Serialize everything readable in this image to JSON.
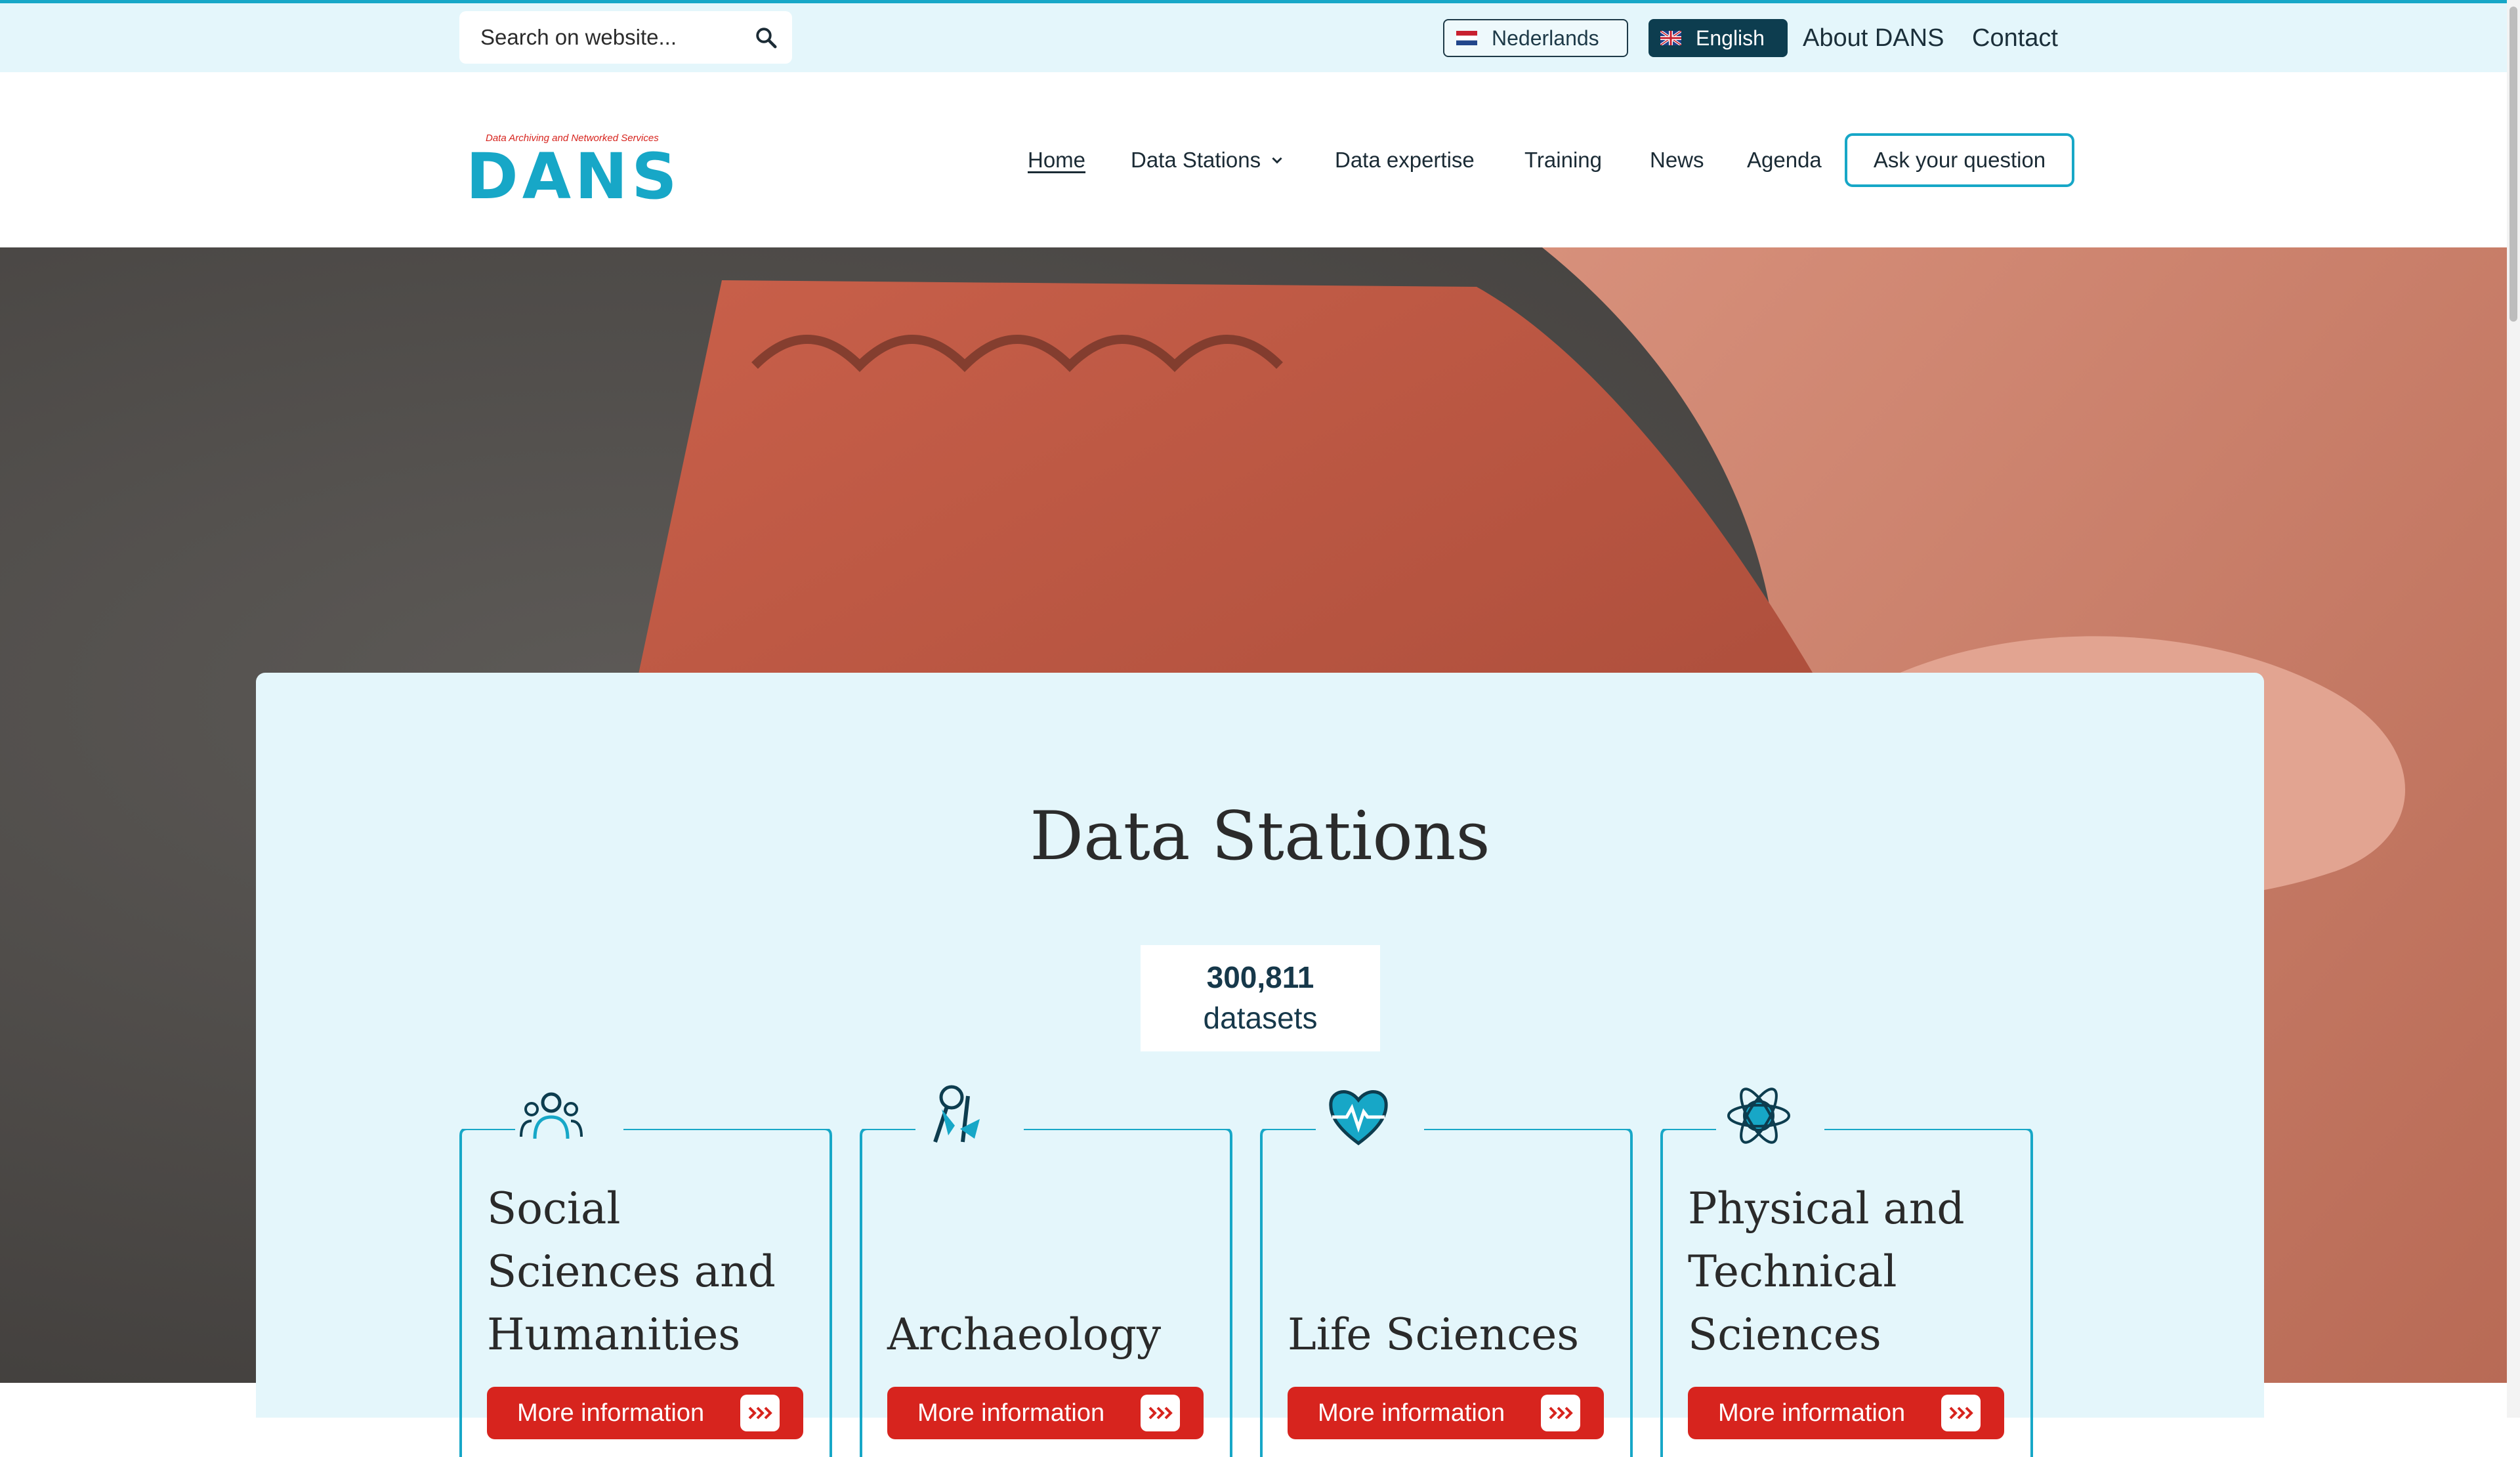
{
  "topbar": {
    "search_placeholder": "Search on website...",
    "languages": [
      {
        "label": "Nederlands",
        "active": false
      },
      {
        "label": "English",
        "active": true
      }
    ],
    "links": [
      "About DANS",
      "Contact"
    ]
  },
  "header": {
    "logo_tagline": "Data Archiving and Networked Services",
    "logo_text": "DANS",
    "nav": [
      "Home",
      "Data Stations",
      "Data expertise",
      "Training",
      "News",
      "Agenda"
    ],
    "cta": "Ask your question"
  },
  "panel": {
    "title": "Data Stations",
    "count": "300,811",
    "count_label": "datasets",
    "cards": [
      {
        "title": "Social Sciences and Humanities",
        "icon": "people-group-icon",
        "button": "More information"
      },
      {
        "title": "Archaeology",
        "icon": "archaeology-tools-icon",
        "button": "More information"
      },
      {
        "title": "Life Sciences",
        "icon": "heart-pulse-icon",
        "button": "More information"
      },
      {
        "title": "Physical and Technical Sciences",
        "icon": "atom-globe-icon",
        "button": "More information"
      }
    ]
  },
  "colors": {
    "accent": "#17a7c7",
    "button_red": "#d7241e",
    "panel_bg": "#e4f6fb",
    "dark_navy": "#0d3d4f"
  }
}
